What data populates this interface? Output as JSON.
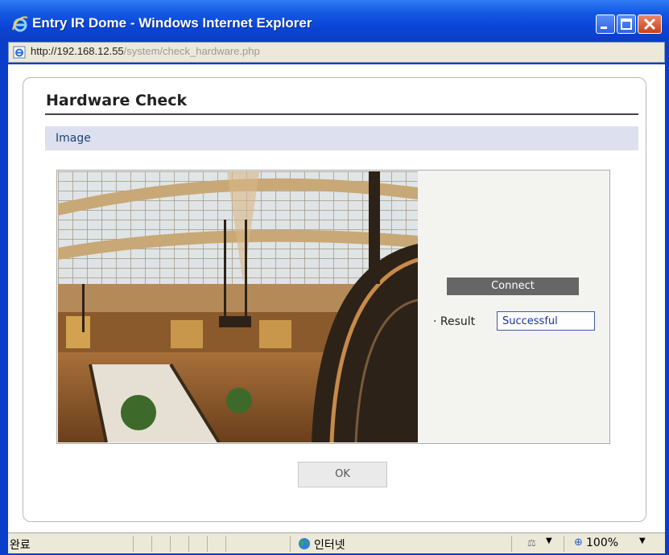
{
  "window": {
    "title": "Entry IR Dome - Windows Internet Explorer",
    "address_host": "http://192.168.12.55",
    "address_path": "/system/check_hardware.php"
  },
  "page": {
    "title": "Hardware Check",
    "section_label": "Image",
    "connect_label": "Connect",
    "result_label": "· Result",
    "result_value": "Successful",
    "ok_label": "OK"
  },
  "statusbar": {
    "status": "완료",
    "zone": "인터넷",
    "zoom": "100%"
  },
  "icons": {
    "browser": "ie-logo-icon",
    "page": "ie-page-icon",
    "zone": "globe-icon",
    "zoom": "magnifier-icon",
    "security": "lock-icon"
  },
  "colors": {
    "titlebar": "#0a45d8",
    "section_bar": "#dde0ee",
    "connect_button": "#666666",
    "result_text": "#1a2fa8"
  }
}
